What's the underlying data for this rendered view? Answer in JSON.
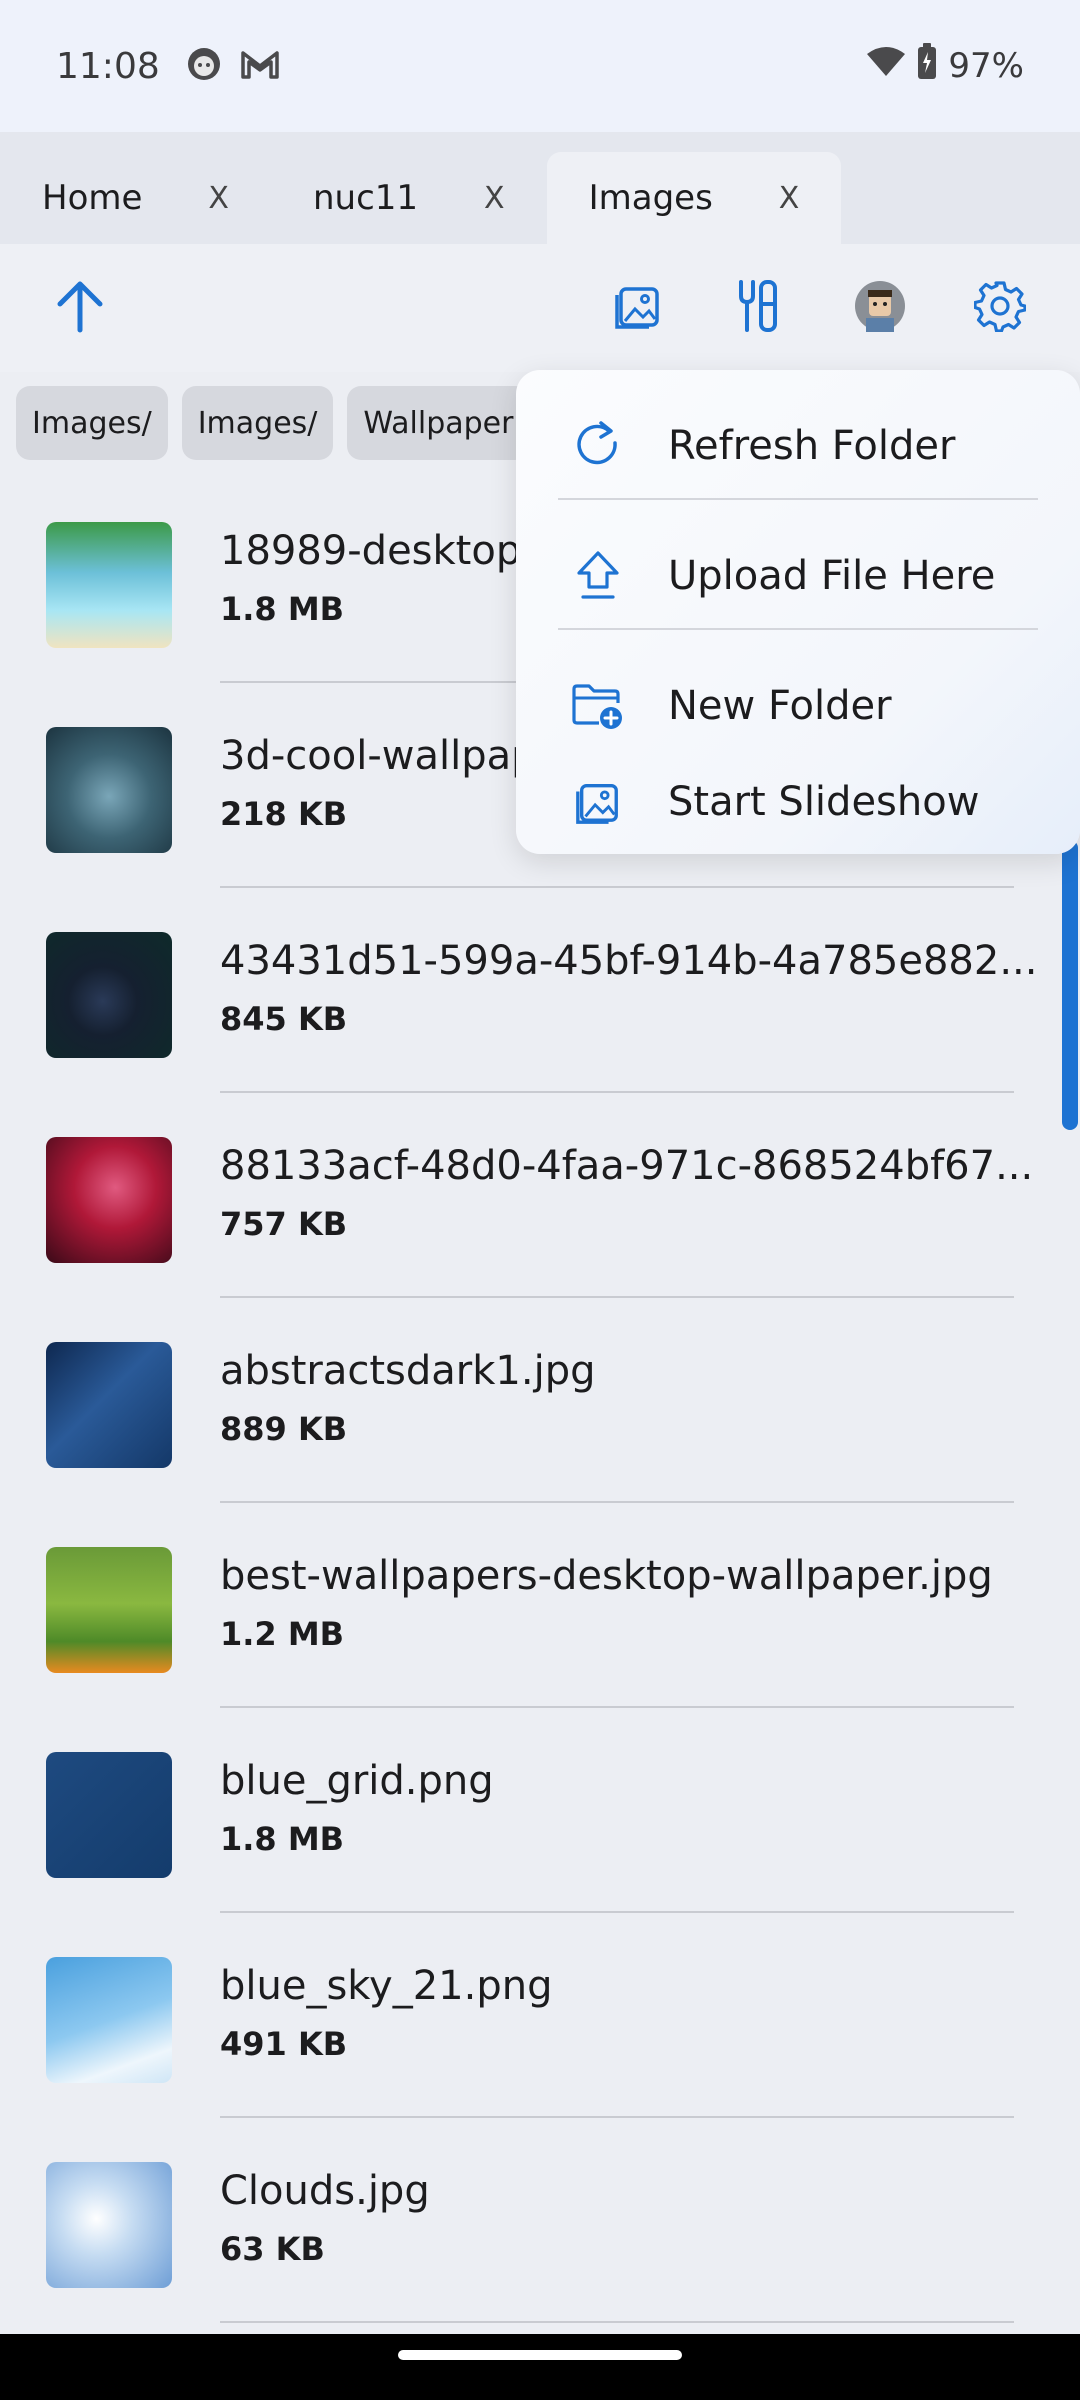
{
  "status_bar": {
    "time": "11:08",
    "battery": "97%",
    "icons": [
      "face-notification-icon",
      "gmail-icon",
      "wifi-icon",
      "battery-icon"
    ]
  },
  "tabs": [
    {
      "label": "Home",
      "close": "X"
    },
    {
      "label": "nuc11",
      "close": "X"
    },
    {
      "label": "Images",
      "close": "X",
      "active": true
    }
  ],
  "toolbar": {
    "buttons": [
      "up-arrow-icon",
      "image-icon",
      "tools-icon",
      "avatar",
      "gear-icon"
    ],
    "accent": "#1e73d2"
  },
  "breadcrumb": [
    "Images/",
    "Images/",
    "Wallpaper"
  ],
  "files": [
    {
      "name": "18989-desktop",
      "size": "1.8 MB"
    },
    {
      "name": "3d-cool-wallpap",
      "size": "218 KB"
    },
    {
      "name": "43431d51-599a-45bf-914b-4a785e882...",
      "size": "845 KB"
    },
    {
      "name": "88133acf-48d0-4faa-971c-868524bf67...",
      "size": "757 KB"
    },
    {
      "name": "abstractsdark1.jpg",
      "size": "889 KB"
    },
    {
      "name": "best-wallpapers-desktop-wallpaper.jpg",
      "size": "1.2 MB"
    },
    {
      "name": "blue_grid.png",
      "size": "1.8 MB"
    },
    {
      "name": "blue_sky_21.png",
      "size": "491 KB"
    },
    {
      "name": "Clouds.jpg",
      "size": "63 KB"
    }
  ],
  "menu": {
    "items": [
      {
        "label": "Refresh Folder",
        "icon": "refresh-icon"
      },
      {
        "label": "Upload File Here",
        "icon": "upload-icon"
      },
      {
        "label": "New Folder",
        "icon": "new-folder-icon"
      },
      {
        "label": "Start Slideshow",
        "icon": "slideshow-icon"
      }
    ]
  }
}
